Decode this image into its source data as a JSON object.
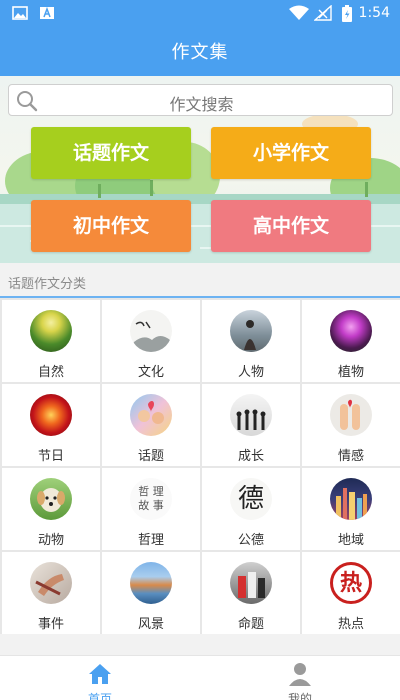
{
  "status_bar": {
    "time": "1:54",
    "icons": [
      "image-icon",
      "a-icon",
      "wifi-icon",
      "signal-icon",
      "battery-icon"
    ]
  },
  "app": {
    "title": "作文集",
    "accent": "#4aa0f0"
  },
  "search": {
    "placeholder": "作文搜索"
  },
  "categories": [
    {
      "label": "话题作文",
      "color": "#a6cf1e"
    },
    {
      "label": "小学作文",
      "color": "#f5ac18"
    },
    {
      "label": "初中作文",
      "color": "#f58a3a"
    },
    {
      "label": "高中作文",
      "color": "#f07a80"
    }
  ],
  "section": {
    "title": "话题作文分类"
  },
  "topics": [
    {
      "label": "自然",
      "icon": "nature-icon"
    },
    {
      "label": "文化",
      "icon": "culture-icon"
    },
    {
      "label": "人物",
      "icon": "person-icon"
    },
    {
      "label": "植物",
      "icon": "plant-icon"
    },
    {
      "label": "节日",
      "icon": "festival-icon"
    },
    {
      "label": "话题",
      "icon": "topic-icon"
    },
    {
      "label": "成长",
      "icon": "growth-icon"
    },
    {
      "label": "情感",
      "icon": "emotion-icon"
    },
    {
      "label": "动物",
      "icon": "animal-icon"
    },
    {
      "label": "哲理",
      "icon": "philosophy-icon"
    },
    {
      "label": "公德",
      "icon": "morality-icon"
    },
    {
      "label": "地域",
      "icon": "region-icon"
    },
    {
      "label": "事件",
      "icon": "event-icon"
    },
    {
      "label": "风景",
      "icon": "scenery-icon"
    },
    {
      "label": "命题",
      "icon": "proposition-icon"
    },
    {
      "label": "热点",
      "icon": "hotspot-icon"
    }
  ],
  "thumb_text": {
    "philosophy": [
      "哲 理",
      "故 事"
    ],
    "morality": "德",
    "hotspot": "热"
  },
  "nav": [
    {
      "label": "首页",
      "icon": "home-icon",
      "active": true,
      "color": "#4aa0f0"
    },
    {
      "label": "我的",
      "icon": "profile-icon",
      "active": false,
      "color": "#888888"
    }
  ]
}
